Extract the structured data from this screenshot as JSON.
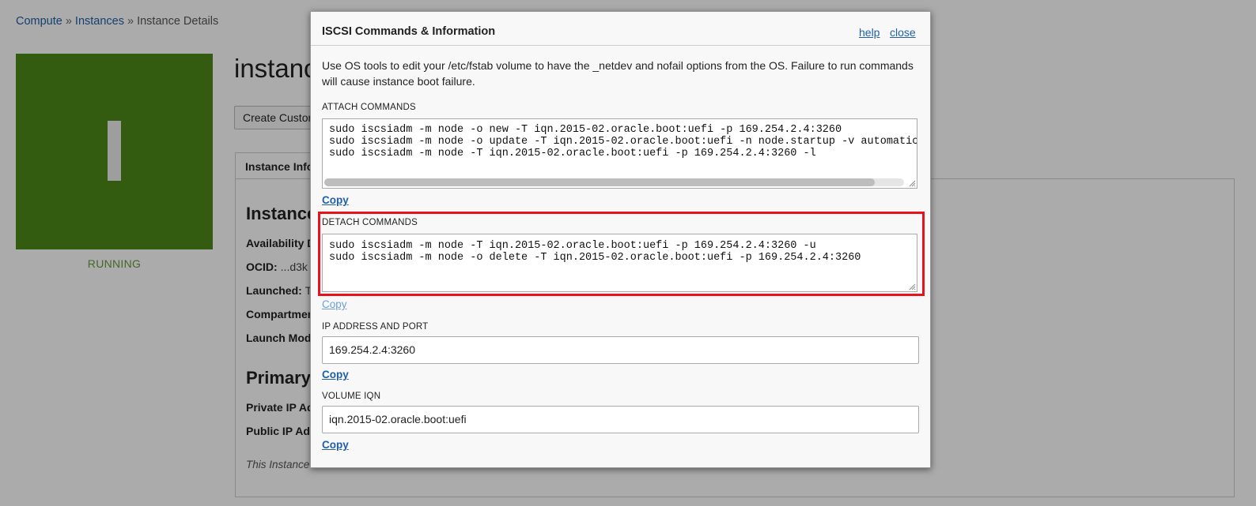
{
  "breadcrumb": {
    "compute": "Compute",
    "sep1": "»",
    "instances": "Instances",
    "sep2": "»",
    "current": "Instance Details"
  },
  "instance": {
    "status": "RUNNING",
    "title": "instance",
    "status_color": "#4e8a18"
  },
  "page": {
    "create_button": "Create Custom",
    "tab_info": "Instance Info",
    "section_instance": "Instance",
    "fields": {
      "availability": "Availability D",
      "ocid_label": "OCID:",
      "ocid_value": "...d3k",
      "launched_label": "Launched:",
      "launched_value": "T",
      "compartment": "Compartment",
      "launch_mode": "Launch Mod"
    },
    "section_primary": "Primary",
    "private_ip": "Private IP Ad",
    "public_ip": "Public IP Add",
    "footer_note": "This Instance"
  },
  "modal": {
    "title": "ISCSI Commands & Information",
    "help": "help",
    "close": "close",
    "intro": "Use OS tools to edit your /etc/fstab volume to have the _netdev and nofail options from the OS. Failure to run commands will cause instance boot failure.",
    "attach": {
      "label": "ATTACH COMMANDS",
      "line1": "sudo iscsiadm -m node -o new -T iqn.2015-02.oracle.boot:uefi -p 169.254.2.4:3260",
      "line2": "sudo iscsiadm -m node -o update -T iqn.2015-02.oracle.boot:uefi -n node.startup -v automatic",
      "line3": "sudo iscsiadm -m node -T iqn.2015-02.oracle.boot:uefi -p 169.254.2.4:3260 -l",
      "copy": "Copy"
    },
    "detach": {
      "label": "DETACH COMMANDS",
      "line1": "sudo iscsiadm -m node -T iqn.2015-02.oracle.boot:uefi -p 169.254.2.4:3260 -u",
      "line2": "sudo iscsiadm -m node -o delete -T iqn.2015-02.oracle.boot:uefi -p 169.254.2.4:3260",
      "copy": "Copy"
    },
    "ip": {
      "label": "IP ADDRESS AND PORT",
      "value": "169.254.2.4:3260",
      "copy": "Copy"
    },
    "iqn": {
      "label": "VOLUME IQN",
      "value": "iqn.2015-02.oracle.boot:uefi",
      "copy": "Copy"
    },
    "highlight_color": "#e8131a"
  }
}
